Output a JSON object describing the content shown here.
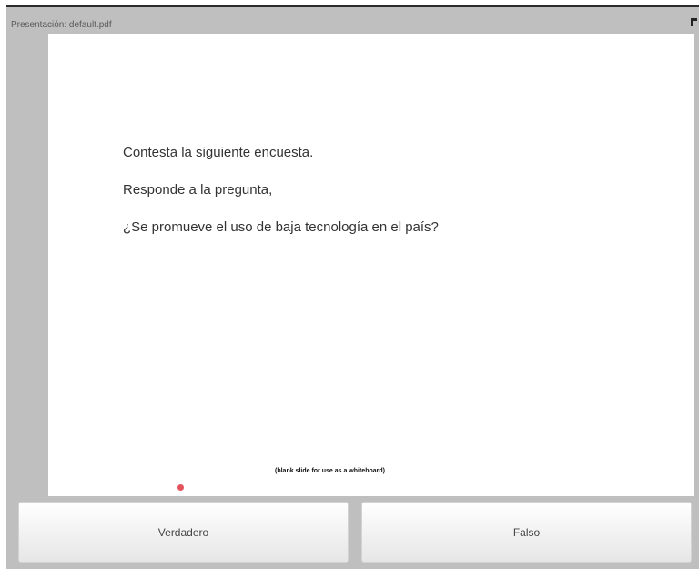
{
  "window": {
    "title": "Presentación: default.pdf"
  },
  "slide": {
    "lines": [
      "Contesta la siguiente encuesta.",
      "Responde a la pregunta,",
      "¿Se promueve el uso de baja tecnología en el país?"
    ],
    "caption": "(blank slide for use as a whiteboard)"
  },
  "answers": {
    "true_label": "Verdadero",
    "false_label": "Falso"
  },
  "colors": {
    "frame": "#bfbfbf",
    "cursor_dot": "#e4535c"
  }
}
